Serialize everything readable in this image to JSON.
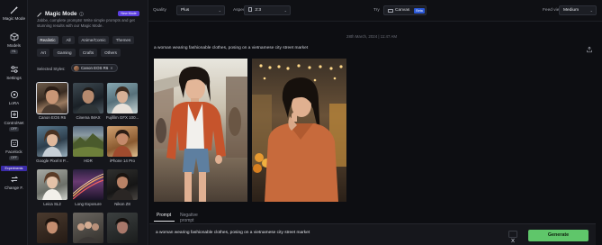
{
  "rail": {
    "items": [
      {
        "label": "Magic Mode",
        "icon": "wand-icon"
      },
      {
        "label": "Models",
        "icon": "cube-icon",
        "badge": "HL"
      },
      {
        "label": "Settings",
        "icon": "sliders-icon"
      },
      {
        "label": "LoRA",
        "icon": "lora-icon"
      },
      {
        "label": "ControlNet",
        "icon": "controlnet-icon",
        "badge": "OFF"
      },
      {
        "label": "Facelock",
        "icon": "face-icon",
        "badge": "OFF"
      },
      {
        "label": "Change F.",
        "icon": "swap-icon"
      }
    ],
    "experiments_label": "Experiments"
  },
  "panel": {
    "title": "Magic Mode",
    "new_badge": "New Mode",
    "description": "Jabbe, complete prompts! Write simple prompts and get stunning results with our Magic Mode.",
    "categories": [
      "Realistic",
      "All",
      "Anime/Comic",
      "Themes",
      "Art",
      "Gaming",
      "Crafts",
      "Others"
    ],
    "selected_styles_label": "Selected Styles:",
    "selected_style": "Canon EOS R6",
    "styles": [
      "Canon EOS R6",
      "Cinema IMAX",
      "Fujifilm GFX 100...",
      "Google Pixel 8 P...",
      "HDR",
      "iPhone 14 Pro",
      "Leica SL2",
      "Long Exposure",
      "Nikon Z8",
      "",
      "",
      ""
    ]
  },
  "topbar": {
    "quality_label": "Quality",
    "quality_value": "Plus",
    "aspect_label": "Aspect ratio",
    "aspect_value": "2:3",
    "try_label": "Try",
    "canvas_label": "Canvas",
    "beta_label": "Beta",
    "feed_view_label": "Feed view",
    "feed_view_value": "Medium"
  },
  "main": {
    "datestamp": "28th March, 2024 | 11:47 AM",
    "prompt_caption": "a woman wearing fashionable clothes, posing on a vietnamese city street market"
  },
  "prompt_area": {
    "tab_prompt": "Prompt",
    "tab_negative": "Negative prompt",
    "text": "a woman wearing fashionable clothes, posing on a vietnamese city street market",
    "generate_label": "Generate"
  },
  "colors": {
    "accent": "#5b3fe0",
    "generate": "#5fc66a",
    "beta": "#2b58d6"
  }
}
